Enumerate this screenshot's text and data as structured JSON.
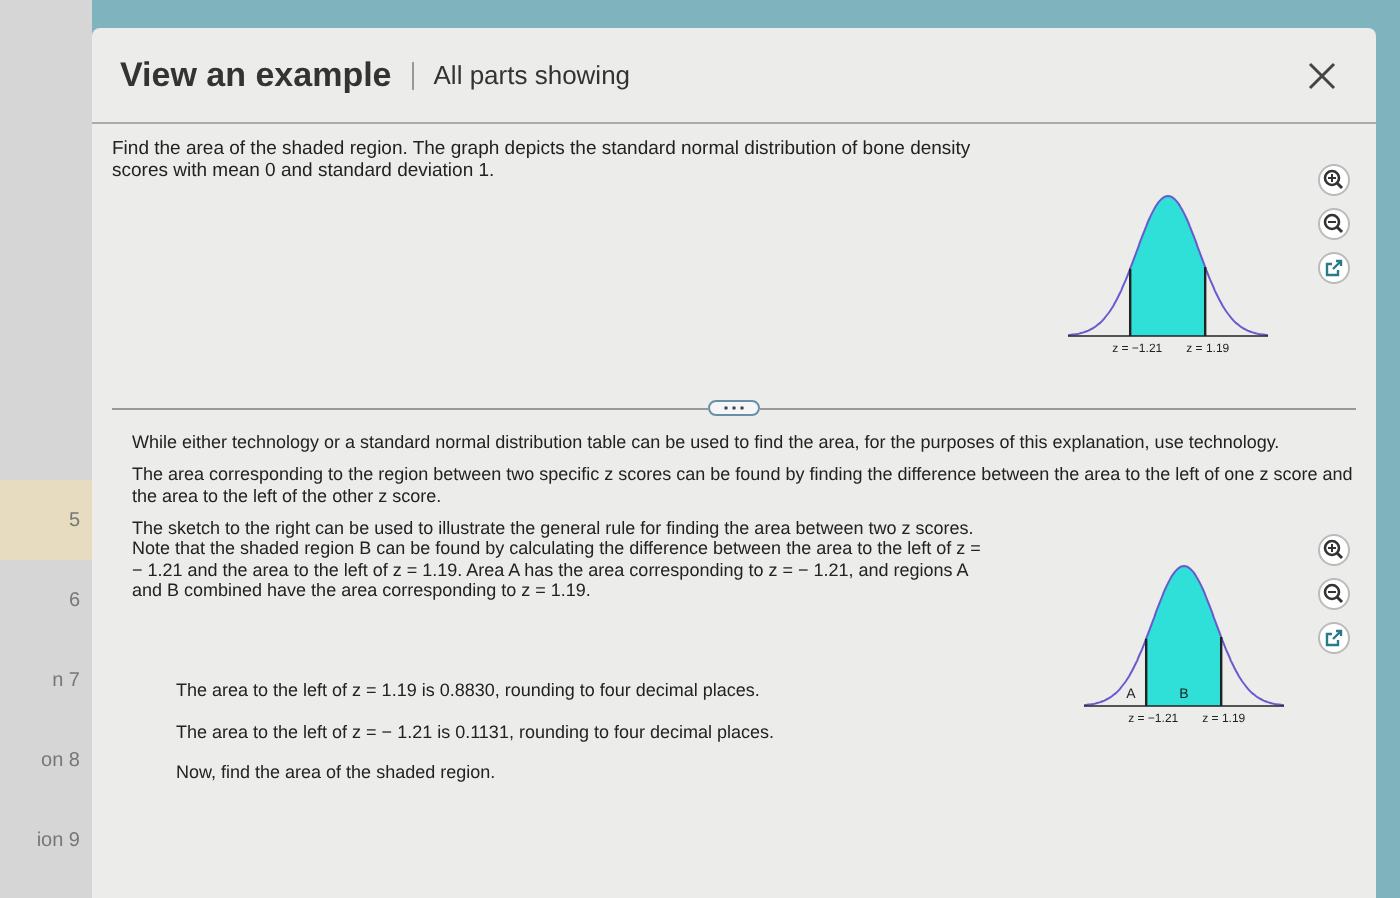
{
  "sidebar": {
    "items": [
      {
        "label": "5",
        "selected": true
      },
      {
        "label": "6",
        "selected": false
      },
      {
        "label": "n 7",
        "selected": false
      },
      {
        "label": "on 8",
        "selected": false
      },
      {
        "label": "ion 9",
        "selected": false
      }
    ]
  },
  "dialog": {
    "title": "View an example",
    "subtitle": "All parts showing",
    "question": "Find the area of the shaded region. The graph depicts the standard normal distribution of bone density scores with mean 0 and standard deviation 1.",
    "figure": {
      "labels": [
        "z = −1.21",
        "z = 1.19"
      ]
    },
    "paragraphs": [
      "While either technology or a standard normal distribution table can be used to find the area, for the purposes of this explanation, use technology.",
      "The area corresponding to the region between two specific z scores can be found by finding the difference between the area to the left of one z score and the area to the left of the other z score."
    ],
    "sketch": {
      "text": "The sketch to the right can be used to illustrate the general rule for finding the area between two z scores. Note that the shaded region B can be found by calculating the difference between the area to the left of z = − 1.21 and the area to the left of z = 1.19. Area A has the area corresponding to z = − 1.21, and regions A and B combined have the area corresponding to z = 1.19.",
      "region_labels": [
        "A",
        "B"
      ],
      "labels": [
        "z = −1.21",
        "z = 1.19"
      ]
    },
    "steps": [
      "The area to the left of z = 1.19 is 0.8830, rounding to four decimal places.",
      "The area to the left of z = − 1.21 is 0.1131, rounding to four decimal places.",
      "Now, find the area of the shaded region."
    ]
  }
}
